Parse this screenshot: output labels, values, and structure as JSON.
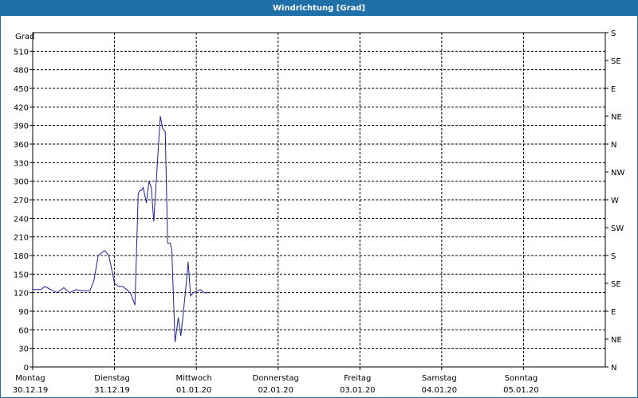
{
  "window": {
    "title": "Windrichtung [Grad]"
  },
  "chart_data": {
    "type": "line",
    "title": "Windrichtung [Grad]",
    "ylabel": "Grad",
    "ylim": [
      0,
      540
    ],
    "yticks": [
      0,
      30,
      60,
      90,
      120,
      150,
      180,
      210,
      240,
      270,
      300,
      330,
      360,
      390,
      420,
      450,
      480,
      510
    ],
    "right_axis_labels": [
      "N",
      "NE",
      "E",
      "SE",
      "S",
      "SW",
      "W",
      "NW",
      "N",
      "NE",
      "E",
      "SE",
      "S"
    ],
    "xlim": [
      0,
      7
    ],
    "x_categories": [
      {
        "day": "Montag",
        "date": "30.12.19"
      },
      {
        "day": "Dienstag",
        "date": "31.12.19"
      },
      {
        "day": "Mittwoch",
        "date": "01.01.20"
      },
      {
        "day": "Donnerstag",
        "date": "02.01.20"
      },
      {
        "day": "Freitag",
        "date": "03.01.20"
      },
      {
        "day": "Samstag",
        "date": "04.01.20"
      },
      {
        "day": "Sonntag",
        "date": "05.01.20"
      }
    ],
    "grid": true,
    "line_color": "#1f1f9a",
    "series": [
      {
        "x": [
          0,
          0.1,
          0.15,
          0.22,
          0.3,
          0.38,
          0.45,
          0.53,
          0.6,
          0.7,
          0.75,
          0.8,
          0.88,
          0.93,
          0.97,
          1.0,
          1.05,
          1.1,
          1.15,
          1.2,
          1.25,
          1.29,
          1.31,
          1.33,
          1.35,
          1.39,
          1.42,
          1.45,
          1.48,
          1.52,
          1.56,
          1.59,
          1.62,
          1.65,
          1.68,
          1.7,
          1.74,
          1.78,
          1.81,
          1.84,
          1.87,
          1.9,
          1.93,
          1.96,
          2.0,
          2.05,
          2.1,
          2.15
        ],
        "y": [
          125,
          125,
          130,
          125,
          120,
          128,
          120,
          125,
          123,
          123,
          140,
          180,
          188,
          180,
          155,
          135,
          130,
          130,
          125,
          118,
          100,
          280,
          285,
          285,
          290,
          265,
          300,
          290,
          235,
          320,
          405,
          385,
          380,
          200,
          200,
          190,
          40,
          80,
          50,
          85,
          125,
          170,
          115,
          120,
          122,
          125,
          120,
          120
        ]
      }
    ]
  }
}
